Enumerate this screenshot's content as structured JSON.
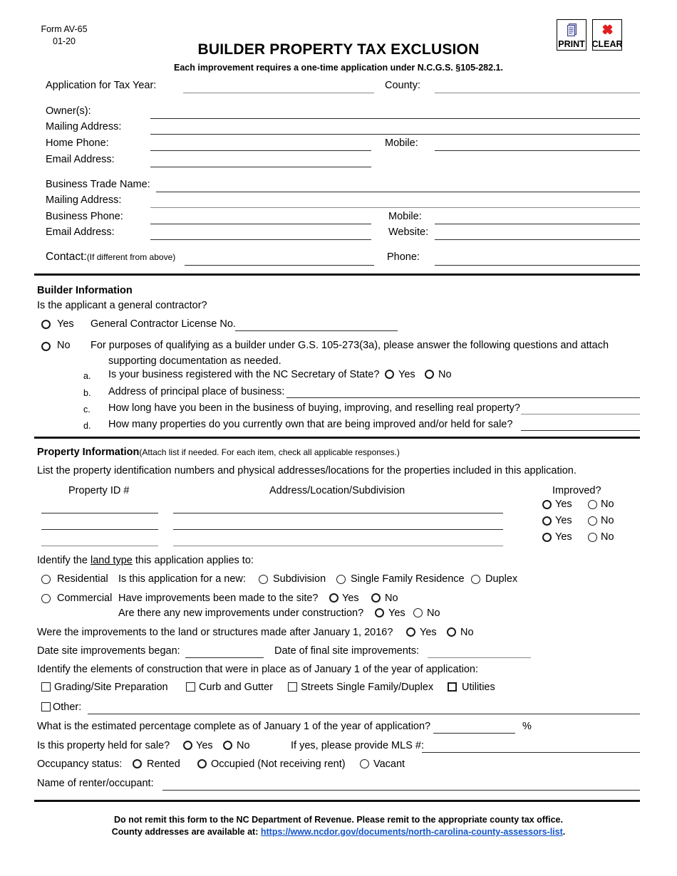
{
  "header": {
    "form_number": "Form AV-65",
    "revision": "01-20",
    "title": "BUILDER PROPERTY TAX EXCLUSION",
    "subtitle": "Each improvement requires a one-time application under N.C.G.S. §105-282.1.",
    "print_button": "PRINT",
    "clear_button": "CLEAR"
  },
  "applicant": {
    "tax_year_label": "Application for Tax Year:",
    "tax_year_value": "",
    "county_label": "County:",
    "county_value": "",
    "owners_label": "Owner(s):",
    "owners_value": "",
    "mailing_address_label": "Mailing Address:",
    "mailing_address_value": "",
    "home_phone_label": "Home Phone:",
    "home_phone_value": "",
    "mobile_label": "Mobile:",
    "mobile_value": "",
    "email_label": "Email Address:",
    "email_value": ""
  },
  "business": {
    "trade_name_label": "Business Trade Name:",
    "trade_name_value": "",
    "mailing_address_label": "Mailing Address:",
    "mailing_address_value": "",
    "phone_label": "Business Phone:",
    "phone_value": "",
    "mobile_label": "Mobile:",
    "mobile_value": "",
    "email_label": "Email Address:",
    "email_value": "",
    "website_label": "Website:",
    "website_value": "",
    "contact_label": "Contact:",
    "contact_note": "(If different from above)",
    "contact_value": "",
    "contact_phone_label": "Phone:",
    "contact_phone_value": ""
  },
  "builder": {
    "section_title": "Builder Information",
    "question": "Is the applicant a general contractor?",
    "yes_label": "Yes",
    "license_label": "General Contractor License No.",
    "license_value": "",
    "no_label": "No",
    "no_text_line1_pre": "For purposes of qualifying as a ",
    "no_text_italic": "builder",
    "no_text_line1_post": " under G.S. 105-273(3a), please answer the following questions and attach",
    "no_text_line2": "supporting documentation as needed.",
    "sub_a_marker": "a.",
    "sub_a_text": "Is your business registered with the NC Secretary of State?",
    "sub_a_yes": "Yes",
    "sub_a_no": "No",
    "sub_b_marker": "b.",
    "sub_b_text": "Address of principal place of business:",
    "sub_b_value": "",
    "sub_c_marker": "c.",
    "sub_c_text": "How long have you been in the business of buying, improving, and reselling real property?",
    "sub_c_value": "",
    "sub_d_marker": "d.",
    "sub_d_text": "How many properties do you currently own that are being improved and/or held for sale?",
    "sub_d_value": ""
  },
  "property": {
    "section_title": "Property Information",
    "section_note": "(Attach list if needed. For each item, check all applicable responses.)",
    "instruction": "List the property identification numbers and physical addresses/locations for the properties included in this application.",
    "col_id": "Property ID #",
    "col_address": "Address/Location/Subdivision",
    "col_improved": "Improved?",
    "rows": [
      {
        "id_value": "",
        "address_value": "",
        "yes_label": "Yes",
        "no_label": "No"
      },
      {
        "id_value": "",
        "address_value": "",
        "yes_label": "Yes",
        "no_label": "No"
      },
      {
        "id_value": "",
        "address_value": "",
        "yes_label": "Yes",
        "no_label": "No"
      }
    ]
  },
  "land": {
    "identify_pre": "Identify the ",
    "identify_underline": "land type",
    "identify_post": " this application applies to:",
    "residential": "Residential",
    "new_question": "Is this application for a new:",
    "subdivision": "Subdivision",
    "single_family": "Single Family Residence",
    "duplex": "Duplex",
    "commercial": "Commercial",
    "improvements_question": "Have improvements been made to the site?",
    "improvements_yes": "Yes",
    "improvements_no": "No",
    "under_construction_question": "Are there any new improvements under construction?",
    "under_construction_yes": "Yes",
    "under_construction_no": "No",
    "after_2016_question": "Were the improvements to the land or structures made after January 1, 2016?",
    "after_2016_yes": "Yes",
    "after_2016_no": "No",
    "date_began_label": "Date site improvements began:",
    "date_began_value": "",
    "date_final_label": "Date of final site improvements:",
    "date_final_value": "",
    "elements_question": "Identify the elements of construction that were in place as of January 1 of the year of application:",
    "chk_grading": "Grading/Site Preparation",
    "chk_curb": "Curb and Gutter",
    "chk_streets": "Streets Single Family/Duplex",
    "chk_utilities": "Utilities",
    "chk_other": "Other:",
    "other_value": "",
    "percent_question": "What is the estimated percentage complete as of January 1 of the year of application?",
    "percent_value": "",
    "percent_symbol": "%",
    "held_for_sale_question": "Is this property held for sale?",
    "held_yes": "Yes",
    "held_no": "No",
    "mls_label": "If yes, please provide MLS #:",
    "mls_value": "",
    "occupancy_label": "Occupancy status:",
    "occ_rented": "Rented",
    "occ_occupied": "Occupied (Not receiving rent)",
    "occ_vacant": "Vacant",
    "renter_label": "Name of renter/occupant:",
    "renter_value": ""
  },
  "footer": {
    "line1": "Do not remit this form to the NC Department of Revenue.  Please remit to the appropriate county tax office.",
    "line2_pre": "County addresses are available at: ",
    "link_text": "https://www.ncdor.gov/documents/north-carolina-county-assessors-list",
    "line2_post": "."
  }
}
